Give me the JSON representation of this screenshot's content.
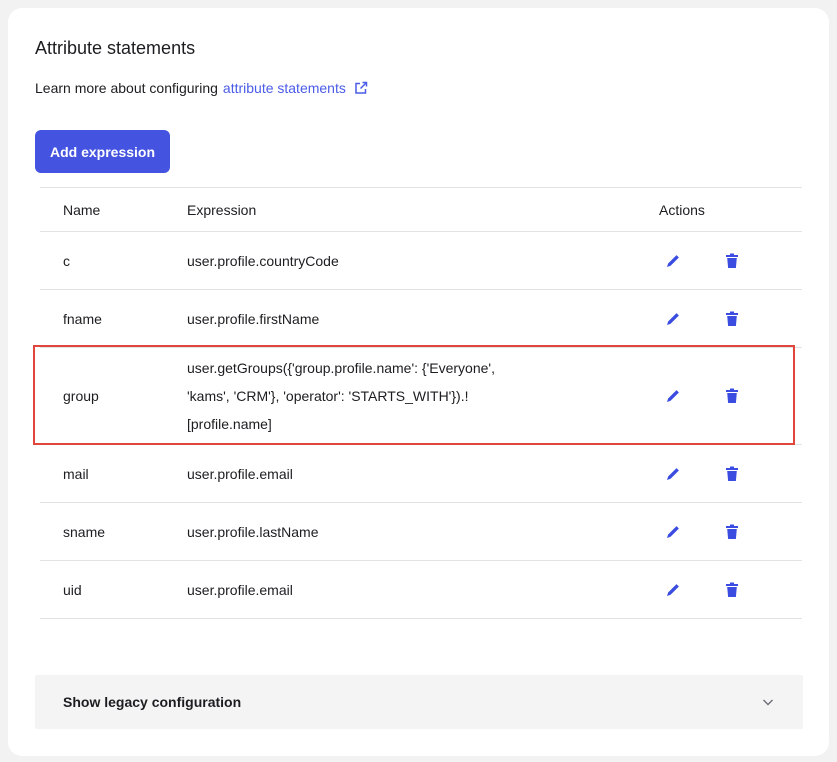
{
  "section": {
    "title": "Attribute statements",
    "learn_prefix": "Learn more about configuring",
    "learn_link": "attribute statements"
  },
  "add_button": "Add expression",
  "table": {
    "headers": {
      "name": "Name",
      "expression": "Expression",
      "actions": "Actions"
    },
    "rows": [
      {
        "name": "c",
        "expression": "user.profile.countryCode"
      },
      {
        "name": "fname",
        "expression": "user.profile.firstName"
      },
      {
        "name": "group",
        "expression_lines": [
          "user.getGroups({'group.profile.name': {'Everyone',",
          "'kams', 'CRM'}, 'operator': 'STARTS_WITH'}).!",
          "[profile.name]"
        ]
      },
      {
        "name": "mail",
        "expression": "user.profile.email"
      },
      {
        "name": "sname",
        "expression": "user.profile.lastName"
      },
      {
        "name": "uid",
        "expression": "user.profile.email"
      }
    ]
  },
  "legacy": {
    "label": "Show legacy configuration"
  },
  "colors": {
    "accent": "#4454e0",
    "highlight": "#e0463c",
    "icon": "#3b4ce0"
  },
  "icons": {
    "edit": "pencil-icon",
    "delete": "trash-icon",
    "external": "external-link-icon",
    "chevron": "chevron-down-icon"
  }
}
